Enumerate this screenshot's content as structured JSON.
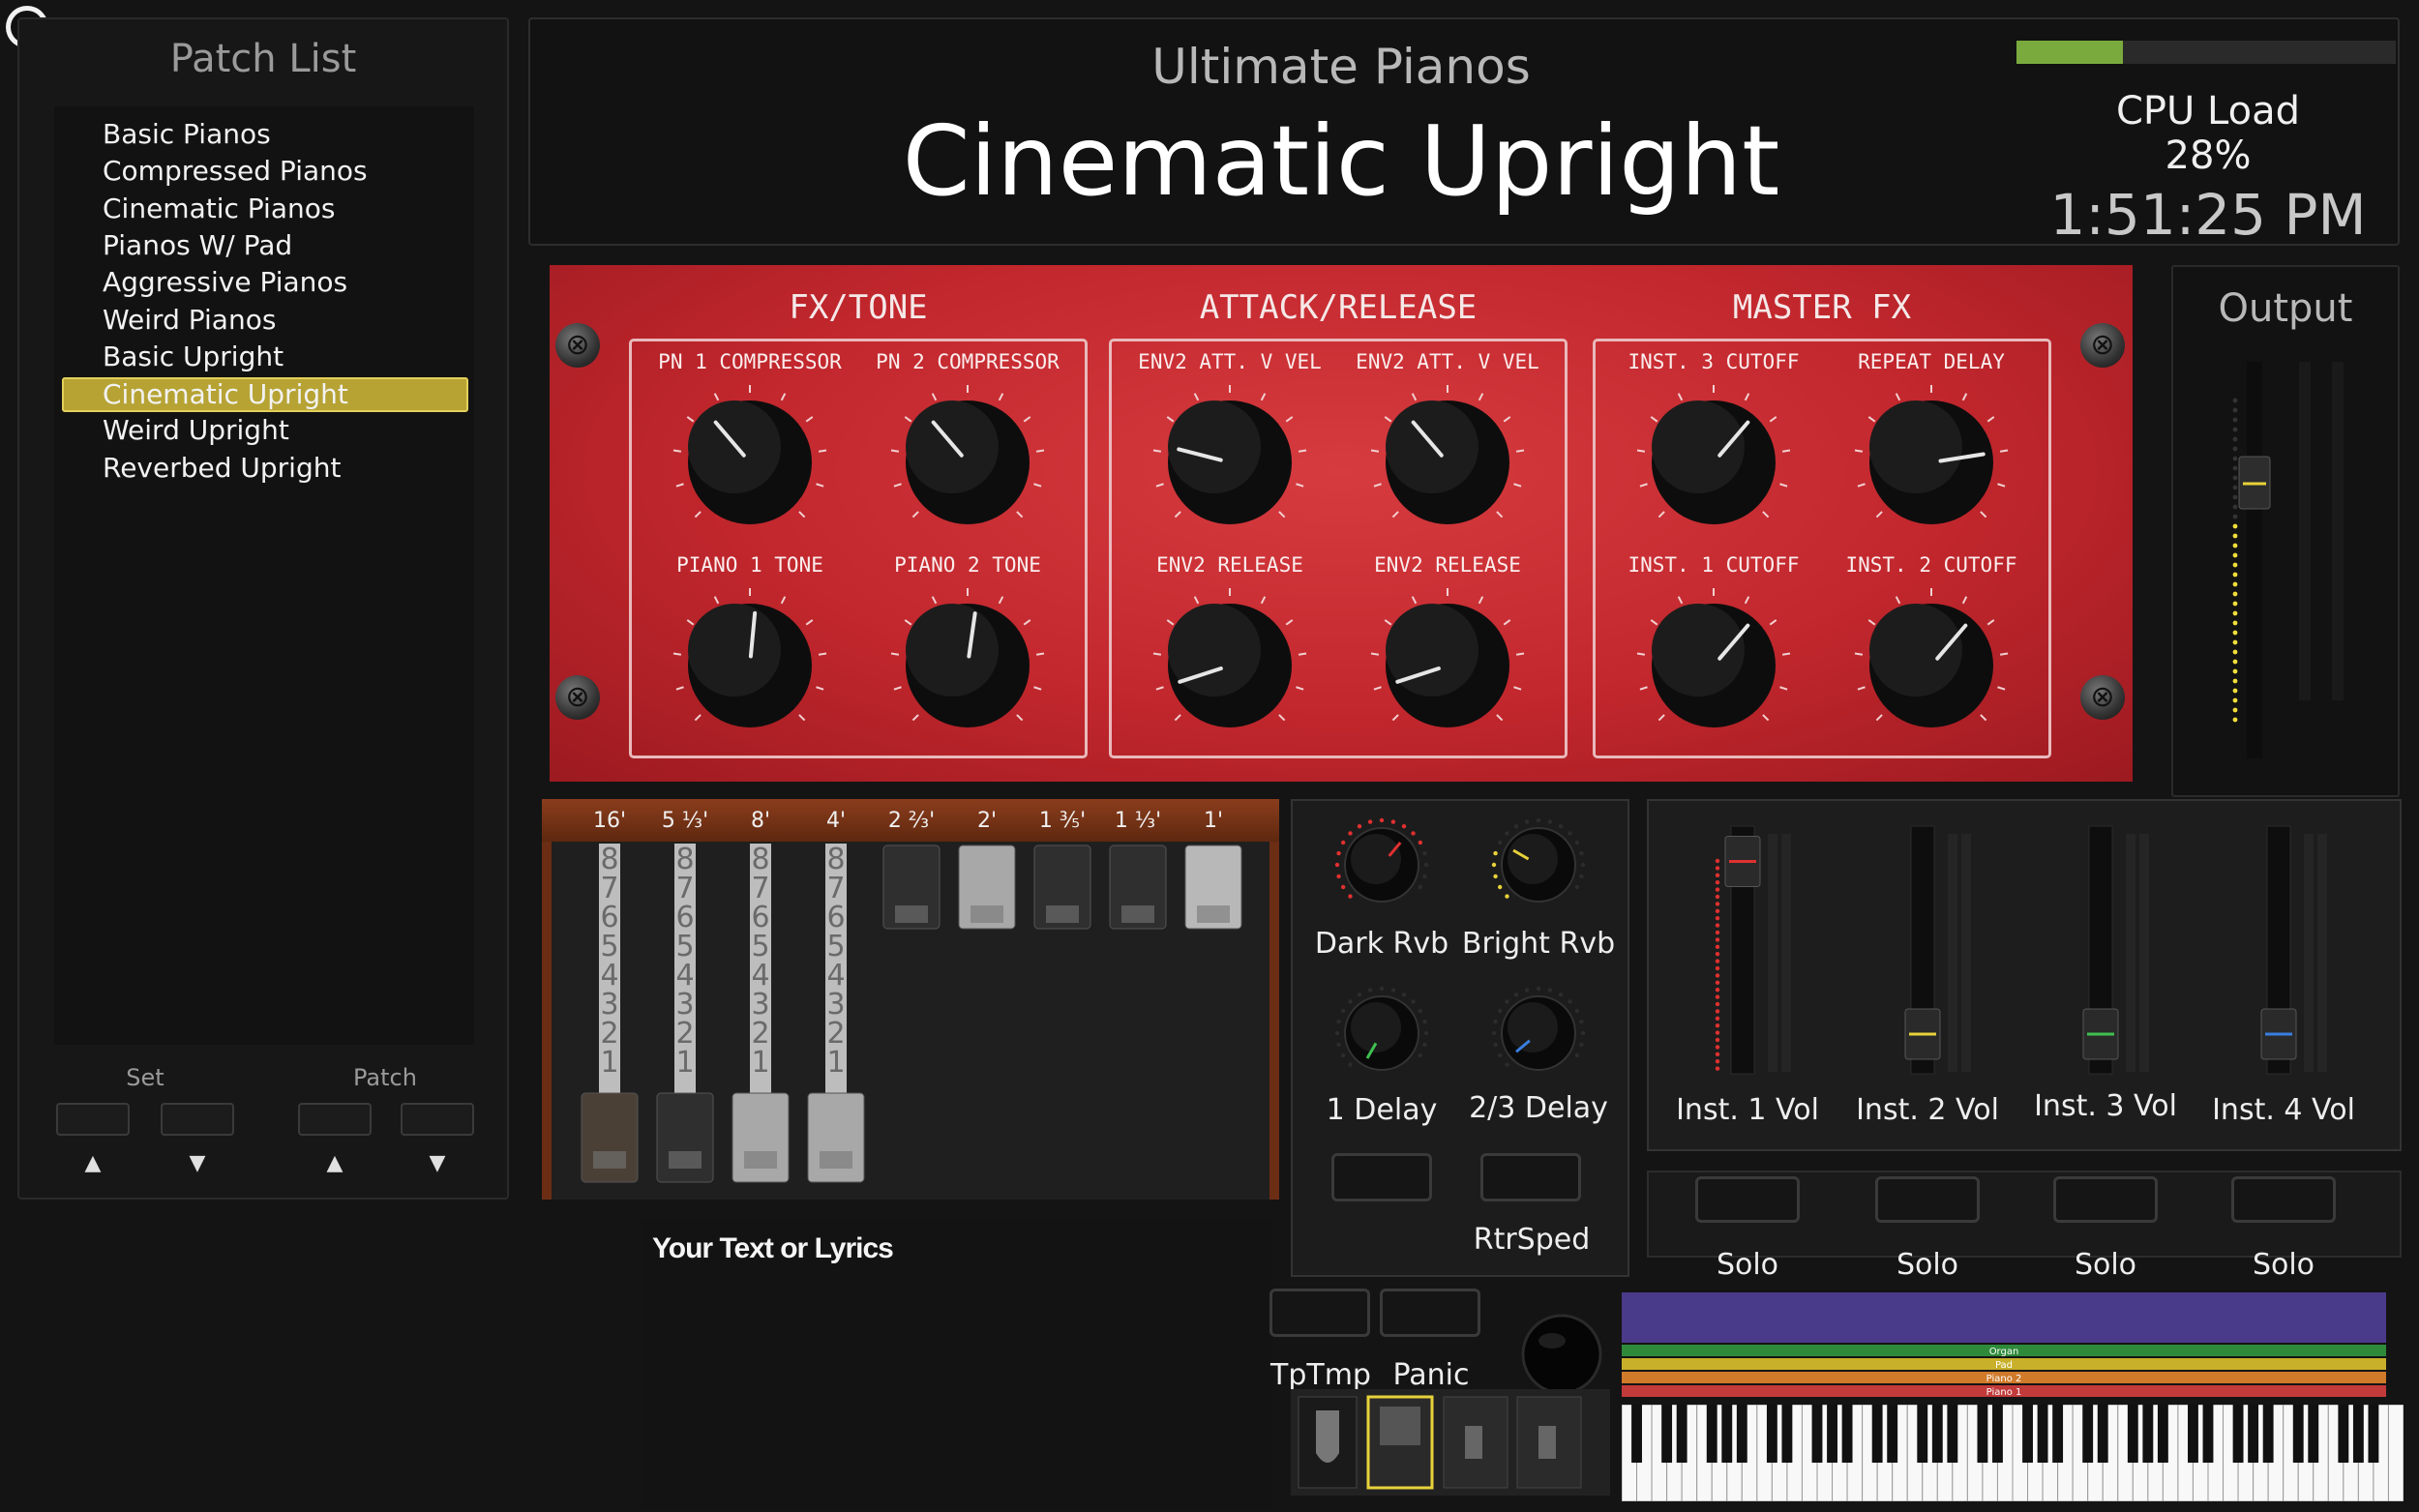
{
  "window": {
    "close_icon": "close-icon"
  },
  "patch_list": {
    "title": "Patch List",
    "items": [
      "Basic Pianos",
      "Compressed Pianos",
      "Cinematic Pianos",
      "Pianos W/ Pad",
      "Aggressive Pianos",
      "Weird Pianos",
      "Basic Upright",
      "Cinematic Upright",
      "Weird Upright",
      "Reverbed Upright"
    ],
    "selected_index": 7,
    "set_label": "Set",
    "patch_label": "Patch",
    "up_arrow": "▲",
    "down_arrow": "▼"
  },
  "header": {
    "subtitle": "Ultimate Pianos",
    "title": "Cinematic Upright",
    "cpu_label": "CPU Load",
    "cpu_value": "28%",
    "cpu_fraction": 0.28,
    "clock": "1:51:25 PM"
  },
  "panel": {
    "sections": [
      {
        "title": "FX/TONE",
        "knobs": [
          {
            "label": "PN 1 COMPRESSOR",
            "value": 0.35
          },
          {
            "label": "PN 2 COMPRESSOR",
            "value": 0.35
          },
          {
            "label": "PIANO 1 TONE",
            "value": 0.52
          },
          {
            "label": "PIANO 2 TONE",
            "value": 0.53
          }
        ]
      },
      {
        "title": "ATTACK/RELEASE",
        "knobs": [
          {
            "label": "ENV2 ATT. V VEL",
            "value": 0.22
          },
          {
            "label": "ENV2 ATT. V VEL",
            "value": 0.35
          },
          {
            "label": "ENV2 RELEASE",
            "value": 0.1
          },
          {
            "label": "ENV2 RELEASE",
            "value": 0.1
          }
        ]
      },
      {
        "title": "MASTER FX",
        "knobs": [
          {
            "label": "INST. 3 CUTOFF",
            "value": 0.65
          },
          {
            "label": "REPEAT DELAY",
            "value": 0.8
          },
          {
            "label": "INST. 1 CUTOFF",
            "value": 0.65
          },
          {
            "label": "INST. 2 CUTOFF",
            "value": 0.65
          }
        ]
      }
    ]
  },
  "output": {
    "title": "Output",
    "level": 0.62
  },
  "drawbars": {
    "labels": [
      "16'",
      "5 ⅓'",
      "8'",
      "4'",
      "2 ⅔'",
      "2'",
      "1 ⅗'",
      "1 ⅓'",
      "1'"
    ],
    "scale": [
      "8",
      "7",
      "6",
      "5",
      "4",
      "3",
      "2",
      "1"
    ]
  },
  "fx_knobs": [
    {
      "label": "Dark Rvb",
      "color": "#e03030"
    },
    {
      "label": "Bright Rvb",
      "color": "#e8d23a"
    },
    {
      "label": "1 Delay",
      "color": "#3fc050"
    },
    {
      "label": "2/3 Delay",
      "color": "#3a7ee0"
    }
  ],
  "rtrsped_label": "RtrSped",
  "volumes": [
    {
      "label": "Inst. 1 Vol",
      "color": "#e03030",
      "level": 0.95
    },
    {
      "label": "Inst. 2 Vol",
      "color": "#e8d23a",
      "level": 0.1
    },
    {
      "label": "Inst. 3 Vol",
      "color": "#3fc050",
      "level": 0.1
    },
    {
      "label": "Inst. 4 Vol",
      "color": "#3a7ee0",
      "level": 0.1
    }
  ],
  "solo_label": "Solo",
  "lyrics": {
    "text": "Your Text or Lyrics"
  },
  "buttons": {
    "tptmp": "TpTmp",
    "panic": "Panic"
  },
  "layers": [
    "Organ",
    "Pad",
    "Piano 2",
    "Piano 1"
  ]
}
